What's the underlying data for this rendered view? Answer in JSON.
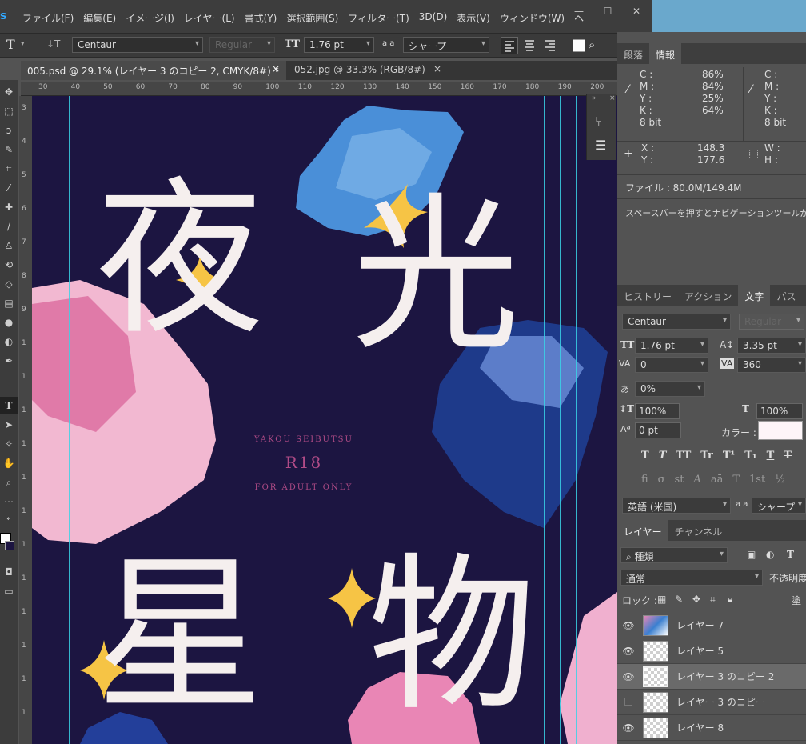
{
  "app": {
    "logo": "s"
  },
  "menu": [
    "ファイル(F)",
    "編集(E)",
    "イメージ(I)",
    "レイヤー(L)",
    "書式(Y)",
    "選択範囲(S)",
    "フィルター(T)",
    "3D(D)",
    "表示(V)",
    "ウィンドウ(W)",
    "ヘ"
  ],
  "window_controls": {
    "minimize": "—",
    "restore": "☐",
    "close": "✕"
  },
  "options": {
    "tool_glyph": "T",
    "orient_glyph": "↓T",
    "font": "Centaur",
    "style": "Regular",
    "size_icon": "TT",
    "size": "1.76 pt",
    "aa_icon": "a a",
    "aa": "シャープ"
  },
  "tabs": [
    {
      "label": "005.psd @ 29.1% (レイヤー 3 のコピー 2, CMYK/8#) *",
      "close": "×"
    },
    {
      "label": "052.jpg @ 33.3% (RGB/8#)",
      "close": "×"
    }
  ],
  "ruler_h": [
    "30",
    "40",
    "50",
    "60",
    "70",
    "80",
    "90",
    "100",
    "110",
    "120",
    "130",
    "140",
    "150",
    "160",
    "170",
    "180",
    "190",
    "200"
  ],
  "ruler_v": [
    "3",
    "4",
    "5",
    "6",
    "7",
    "8",
    "9",
    "1",
    "1",
    "1",
    "1",
    "1",
    "1",
    "1",
    "1",
    "1",
    "1",
    "1",
    "1"
  ],
  "artwork": {
    "kanji": [
      "夜",
      "光",
      "星",
      "物"
    ],
    "line1": "YAKOU SEIBUTSU",
    "line2": "R18",
    "line3": "FOR ADULT ONLY"
  },
  "colors": {
    "canvas": "#1c1541",
    "star": "#f6c445",
    "pink": "#e986b5",
    "blue": "#3a7fd0",
    "guide": "#3ad2e6",
    "text_pink": "#b04b86"
  },
  "info_panel": {
    "tabs": [
      "段落",
      "情報"
    ],
    "left": {
      "c_label": "C :",
      "c": "86%",
      "m_label": "M :",
      "m": "84%",
      "y_label": "Y :",
      "y": "25%",
      "k_label": "K :",
      "k": "64%",
      "bit": "8 bit"
    },
    "right": {
      "c_label": "C :",
      "m_label": "M :",
      "y_label": "Y :",
      "k_label": "K :",
      "bit": "8 bit"
    },
    "x_label": "X :",
    "x": "148.3",
    "y_label": "Y :",
    "y": "177.6",
    "w_label": "W :",
    "h_label": "H :",
    "file": "ファイル : 80.0M/149.4M",
    "hint": "スペースバーを押すとナビゲーションツールが"
  },
  "char_panel": {
    "tabs": [
      "ヒストリー",
      "アクション",
      "文字",
      "パス"
    ],
    "font": "Centaur",
    "style": "Regular",
    "size": "1.76 pt",
    "leading": "3.35 pt",
    "kerning": "0",
    "tracking": "360",
    "tsume": "0%",
    "vscale": "100%",
    "hscale": "100%",
    "baseline": "0 pt",
    "color_label": "カラー :",
    "glyph_row1": [
      "T",
      "T",
      "TT",
      "Tr",
      "T¹",
      "T₁",
      "T",
      "T"
    ],
    "glyph_row2": [
      "ﬁ",
      "σ",
      "st",
      "A",
      "aā",
      "T",
      "1st",
      "½"
    ],
    "lang": "英語 (米国)",
    "aa_icon": "a a",
    "aa": "シャープ"
  },
  "layers_panel": {
    "tabs": [
      "レイヤー",
      "チャンネル"
    ],
    "filter": "種類",
    "blend": "通常",
    "opacity_label": "不透明度",
    "lock_label": "ロック :",
    "fill_label": "塗",
    "layers": [
      {
        "name": "レイヤー 7",
        "visible": true
      },
      {
        "name": "レイヤー 5",
        "visible": true
      },
      {
        "name": "レイヤー 3 のコピー 2",
        "visible": true,
        "selected": true
      },
      {
        "name": "レイヤー 3 のコピー",
        "visible": false
      },
      {
        "name": "レイヤー 8",
        "visible": true
      }
    ]
  }
}
